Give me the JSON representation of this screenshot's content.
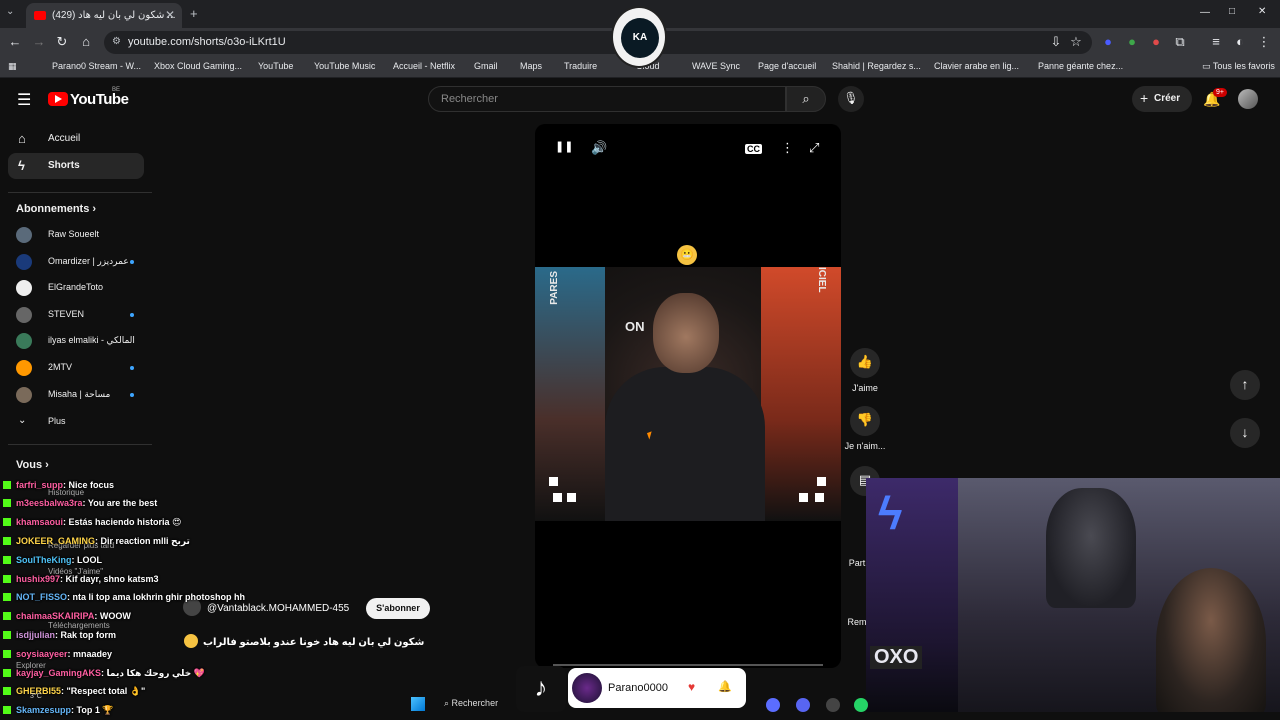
{
  "browser": {
    "tab_title": "(429) شكون لي بان ليه هاد ...",
    "tab_close": "✕",
    "new_tab": "+",
    "url": "youtube.com/shorts/o3o-iLKrt1U",
    "window_controls": [
      "—",
      "□",
      "✕"
    ],
    "bookmarks": [
      {
        "label": "Parano0 Stream - W...",
        "color": "#53fc18"
      },
      {
        "label": "Xbox Cloud Gaming...",
        "color": "#107c10"
      },
      {
        "label": "YouTube",
        "color": "#ff0000"
      },
      {
        "label": "YouTube Music",
        "color": "#ff0000"
      },
      {
        "label": "Accueil - Netflix",
        "color": "#e50914"
      },
      {
        "label": "Gmail",
        "color": "#ea4335"
      },
      {
        "label": "Maps",
        "color": "#34a853"
      },
      {
        "label": "Traduire",
        "color": "#4285f4"
      },
      {
        "label": "Cloud",
        "color": "#ffb300"
      },
      {
        "label": "WAVE Sync",
        "color": "#f5a623"
      },
      {
        "label": "Page d'accueil",
        "color": "#666666"
      },
      {
        "label": "Shahid | Regardez s...",
        "color": "#1ed760"
      },
      {
        "label": "Clavier arabe en lig...",
        "color": "#8bc34a"
      },
      {
        "label": "Panne géante chez...",
        "color": "#3f51b5"
      }
    ],
    "all_bookmarks": "Tous les favoris",
    "badge_text": "KA"
  },
  "youtube": {
    "logo_text": "YouTube",
    "region": "BE",
    "search_placeholder": "Rechercher",
    "create_label": "Créer",
    "notif_count": "9+"
  },
  "sidebar": {
    "home": "Accueil",
    "shorts": "Shorts",
    "subscriptions_title": "Abonnements",
    "subscriptions": [
      {
        "name": "Raw Soueelt",
        "color": "#5a6a7a",
        "live": false
      },
      {
        "name": "Omardizer | عمرديزر",
        "color": "#1a3a7a",
        "live": true
      },
      {
        "name": "ElGrandeToto",
        "color": "#eeeeee",
        "live": false
      },
      {
        "name": "STEVEN",
        "color": "#666666",
        "live": true
      },
      {
        "name": "ilyas elmaliki - المالكي",
        "color": "#3a7a5a",
        "live": false
      },
      {
        "name": "2MTV",
        "color": "#ff9800",
        "live": true
      },
      {
        "name": "Misaha | مساحة",
        "color": "#7a6a5a",
        "live": true
      }
    ],
    "more": "Plus",
    "you_title": "Vous",
    "ghost_items": [
      "Historique",
      "Regarder plus tard",
      "Vidéos \"J'aime\"",
      "Téléchargements",
      "Explorer"
    ]
  },
  "player": {
    "pause_icon": "❚❚",
    "volume_icon": "🔊",
    "cc_label": "CC",
    "more_icon": "⋮",
    "fullscreen_icon": "⤢",
    "video_word_left": "PARES",
    "video_word_right": "ICIEL",
    "video_word_center": "ON",
    "emoji": "😬"
  },
  "actions": {
    "like": "J'aime",
    "dislike": "Je n'aim...",
    "share_partial": "Part",
    "remix_partial": "Rem"
  },
  "shorts_info": {
    "channel": "@Vantablack.MOHAMMED-455",
    "subscribe": "S'abonner",
    "caption": "شكون لي بان ليه هاد خونا عندو بلاصتو فالراب"
  },
  "chat": [
    {
      "user": "farfri_supp",
      "text": ": Nice focus"
    },
    {
      "user": "m3eesbalwa3ra",
      "text": ": You are the best"
    },
    {
      "user": "khamsaoui",
      "text": ": Estás haciendo historia 😍"
    },
    {
      "user": "JOKEER_GAMING",
      "text": ": Dir reaction mlli تربح"
    },
    {
      "user": "SoulTheKing",
      "text": ": LOOL"
    },
    {
      "user": "hushix997",
      "text": ": Kif dayr, shno katsm3"
    },
    {
      "user": "NOT_FISSO",
      "text": ": nta li top ama lokhrin ghir photoshop hh"
    },
    {
      "user": "chaimaaSKAIRIPA",
      "text": ": WOOW"
    },
    {
      "user": "isdjjulian",
      "text": ": Rak top form"
    },
    {
      "user": "soysiaayeer",
      "text": ": mnaadey"
    },
    {
      "user": "kayjay_GamingAKS",
      "text": ": خلي روحك هكا ديما 💖"
    },
    {
      "user": "GHERBI55",
      "text": ": \"Respect total 👌\""
    },
    {
      "user": "Skamzesupp",
      "text": ": Top 1 🏆"
    }
  ],
  "tiktok": {
    "logo": "♪",
    "username": "Parano0000",
    "heart": "♥",
    "bell": "🔔"
  },
  "taskbar": {
    "search": "Rechercher",
    "weather": "3°C"
  },
  "webcam": {
    "brand": "OXO"
  }
}
